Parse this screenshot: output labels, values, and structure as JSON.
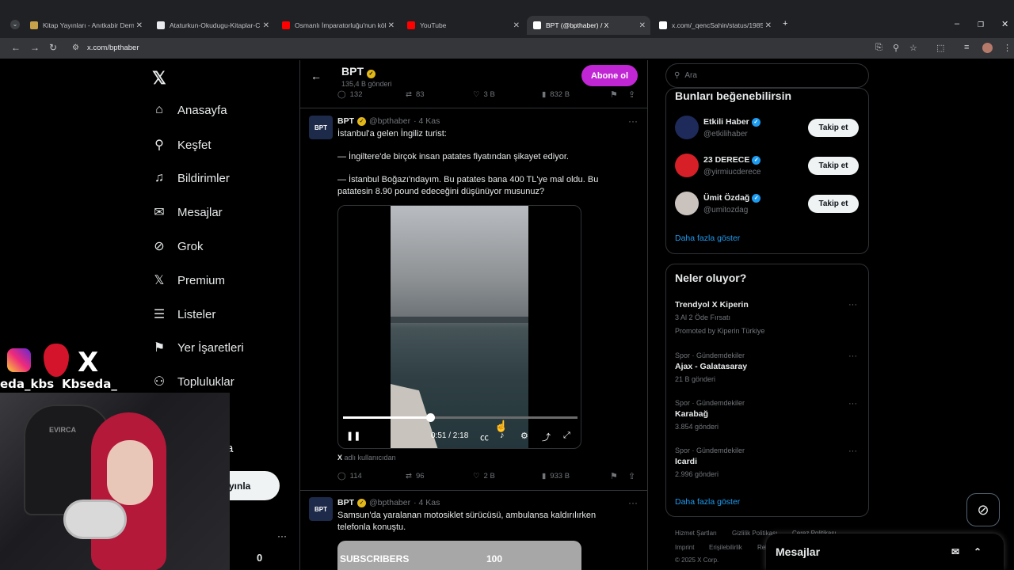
{
  "browser": {
    "tabs": [
      {
        "title": "Kitap Yayınları - Anıtkabir Derne",
        "color": "#c8a24a"
      },
      {
        "title": "Ataturkun-Okudugu-Kitaplar-C",
        "color": "#e8eaed"
      },
      {
        "title": "Osmanlı İmparatorluğu'nun kök",
        "color": "#ff0000"
      },
      {
        "title": "YouTube",
        "color": "#ff0000"
      },
      {
        "title": "BPT (@bpthaber) / X",
        "color": "#ffffff"
      },
      {
        "title": "x.com/_qencSahin/status/1985",
        "color": "#ffffff"
      }
    ],
    "url": "x.com/bpthaber"
  },
  "nav": {
    "items": [
      {
        "label": "Anasayfa",
        "icon": "home-icon",
        "glyph": "⌂"
      },
      {
        "label": "Keşfet",
        "icon": "search-icon",
        "glyph": "⚲"
      },
      {
        "label": "Bildirimler",
        "icon": "bell-icon",
        "glyph": "♫"
      },
      {
        "label": "Mesajlar",
        "icon": "mail-icon",
        "glyph": "✉"
      },
      {
        "label": "Grok",
        "icon": "grok-icon",
        "glyph": "⊘"
      },
      {
        "label": "Premium",
        "icon": "x-icon",
        "glyph": "𝕏"
      },
      {
        "label": "Listeler",
        "icon": "list-icon",
        "glyph": "☰"
      },
      {
        "label": "Yer İşaretleri",
        "icon": "bookmark-icon",
        "glyph": "⚑"
      },
      {
        "label": "Topluluklar",
        "icon": "people-icon",
        "glyph": "⚇"
      }
    ],
    "partial_a": "a",
    "signup_partial": "yınla",
    "more": "···",
    "zero": "0"
  },
  "profile": {
    "name": "BPT",
    "post_count": "135,4 B gönderi",
    "subscribe": "Abone ol"
  },
  "prev_tweet_actions": {
    "replies": "132",
    "retweets": "83",
    "likes": "3 B",
    "views": "832 B"
  },
  "tweet1": {
    "name": "BPT",
    "handle": "@bpthaber",
    "date": "· 4 Kas",
    "lines": [
      "İstanbul'a gelen İngiliz turist:",
      "— İngiltere'de birçok insan patates fiyatından şikayet ediyor.",
      "— İstanbul Boğazı'ndayım. Bu patates bana 400 TL'ye mal oldu. Bu patatesin 8.90 pound edeceğini düşünüyor musunuz?"
    ],
    "video_time": "0:51 / 2:18",
    "video_progress": 0.37,
    "via": "adlı kullanıcıdan",
    "via_logo": "X",
    "actions": {
      "replies": "114",
      "retweets": "96",
      "likes": "2 B",
      "views": "933 B"
    }
  },
  "tweet2": {
    "name": "BPT",
    "handle": "@bpthaber",
    "date": "· 4 Kas",
    "lines": [
      "Samsun'da yaralanan motosiklet sürücüsü, ambulansa kaldırılırken telefonla konuştu."
    ],
    "thumb_left": "SUBSCRIBERS",
    "thumb_right": "100"
  },
  "search": {
    "placeholder": "Ara"
  },
  "suggestions": {
    "title": "Bunları beğenebilirsin",
    "items": [
      {
        "name": "Etkili Haber",
        "handle": "@etkilihaber",
        "button": "Takip et",
        "color": "#1e2a5a"
      },
      {
        "name": "23 DERECE",
        "handle": "@yirmiucderece",
        "button": "Takip et",
        "color": "#d61f26"
      },
      {
        "name": "Ümit Özdağ",
        "handle": "@umitozdag",
        "button": "Takip et",
        "color": "#c9c2bd"
      }
    ],
    "more": "Daha fazla göster"
  },
  "trends": {
    "title": "Neler oluyor?",
    "items": [
      {
        "category": "",
        "title": "Trendyol X Kiperin",
        "count": "3 Al 2 Öde Fırsatı",
        "promo": "Promoted by Kiperin Türkiye"
      },
      {
        "category": "Spor · Gündemdekiler",
        "title": "Ajax - Galatasaray",
        "count": "21 B gönderi"
      },
      {
        "category": "Spor · Gündemdekiler",
        "title": "Karabağ",
        "count": "3.854 gönderi"
      },
      {
        "category": "Spor · Gündemdekiler",
        "title": "Icardi",
        "count": "2.996 gönderi"
      }
    ],
    "more": "Daha fazla göster"
  },
  "footer": {
    "row1": [
      "Hizmet Şartları",
      "Gizlilik Politikası",
      "Çerez Politikası"
    ],
    "row2": [
      "Imprint",
      "Erişilebilirlik",
      "Rek"
    ],
    "copyright": "© 2025 X Corp."
  },
  "messages": {
    "label": "Mesajlar"
  },
  "overlay": {
    "handle1": "eda_kbs",
    "handle2": "Kbseda_",
    "cam_brand": "EVIRCA"
  }
}
